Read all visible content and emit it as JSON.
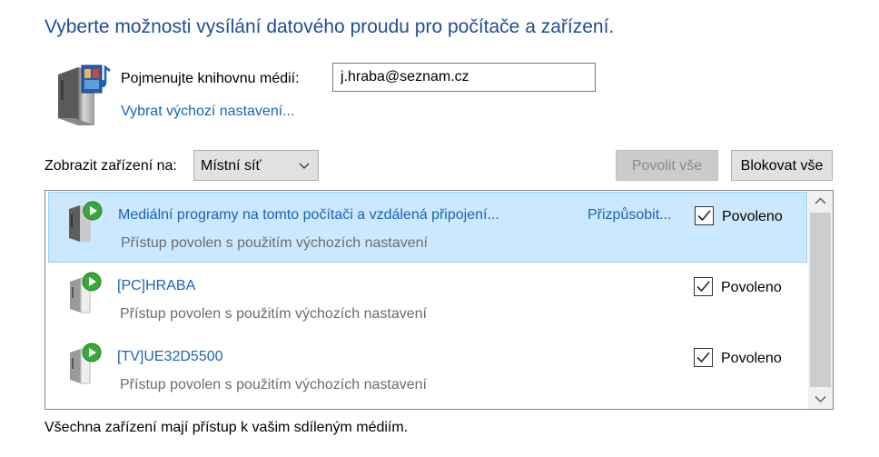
{
  "title": "Vyberte možnosti vysílání datového proudu pro počítače a zařízení.",
  "library": {
    "name_label": "Pojmenujte knihovnu médií:",
    "name_value": "j.hraba@seznam.cz",
    "defaults_link": "Vybrat výchozí nastavení..."
  },
  "filter": {
    "label": "Zobrazit zařízení na:",
    "selected": "Místní síť"
  },
  "buttons": {
    "allow_all": "Povolit vše",
    "block_all": "Blokovat vše"
  },
  "devices": [
    {
      "name": "Mediální programy na tomto počítači a vzdálená připojení...",
      "status": "Přístup povolen s použitím výchozích nastavení",
      "customize": "Přizpůsobit...",
      "checkbox_label": "Povoleno",
      "checked": true,
      "selected": true
    },
    {
      "name": "[PC]HRABA",
      "status": "Přístup povolen s použitím výchozích nastavení",
      "checkbox_label": "Povoleno",
      "checked": true
    },
    {
      "name": "[TV]UE32D5500",
      "status": "Přístup povolen s použitím výchozích nastavení",
      "checkbox_label": "Povoleno",
      "checked": true
    }
  ],
  "footer": "Všechna zařízení mají přístup k vašim sdíleným médiím.",
  "colors": {
    "title": "#1e4e94",
    "link": "#1a64b5",
    "selection": "#cce8ff",
    "play_green": "#3aa838"
  }
}
